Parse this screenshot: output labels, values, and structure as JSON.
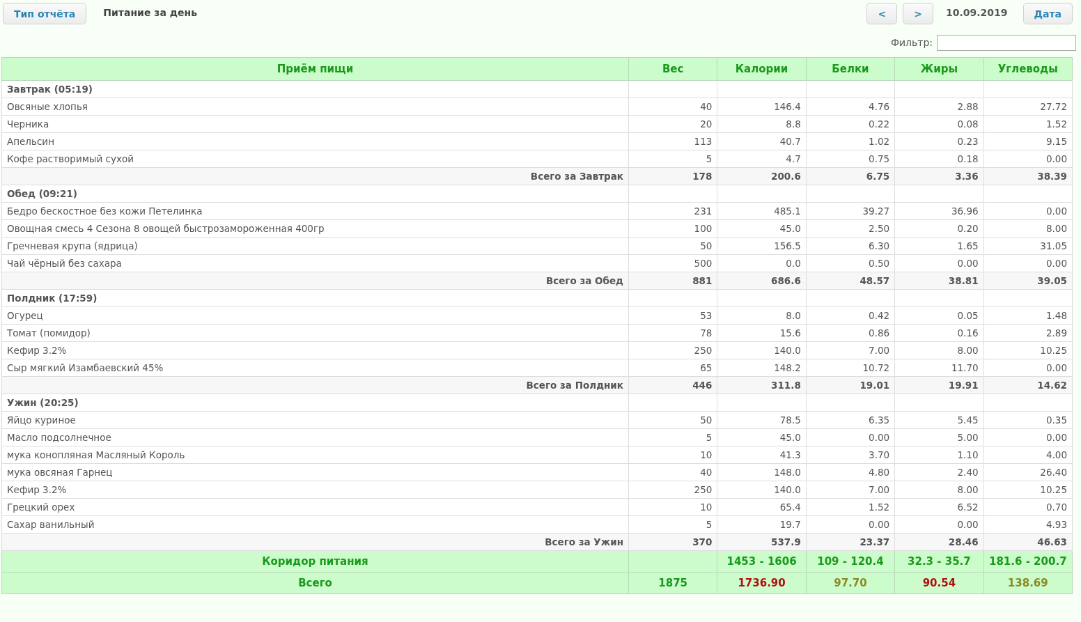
{
  "toolbar": {
    "report_type_button": "Тип отчёта",
    "report_title": "Питание за день",
    "prev_button": "<",
    "next_button": ">",
    "date": "10.09.2019",
    "date_button": "Дата"
  },
  "filter": {
    "label": "Фильтр:"
  },
  "table": {
    "columns": [
      "Приём пищи",
      "Вес",
      "Калории",
      "Белки",
      "Жиры",
      "Углеводы"
    ],
    "meals": [
      {
        "title": "Завтрак (05:19)",
        "items": [
          {
            "name": "Овсяные хлопья",
            "values": [
              "40",
              "146.4",
              "4.76",
              "2.88",
              "27.72"
            ]
          },
          {
            "name": "Черника",
            "values": [
              "20",
              "8.8",
              "0.22",
              "0.08",
              "1.52"
            ]
          },
          {
            "name": "Апельсин",
            "values": [
              "113",
              "40.7",
              "1.02",
              "0.23",
              "9.15"
            ]
          },
          {
            "name": "Кофе растворимый сухой",
            "values": [
              "5",
              "4.7",
              "0.75",
              "0.18",
              "0.00"
            ]
          }
        ],
        "total": {
          "label": "Всего за Завтрак",
          "values": [
            "178",
            "200.6",
            "6.75",
            "3.36",
            "38.39"
          ]
        }
      },
      {
        "title": "Обед (09:21)",
        "items": [
          {
            "name": "Бедро бескостное без кожи Петелинка",
            "values": [
              "231",
              "485.1",
              "39.27",
              "36.96",
              "0.00"
            ]
          },
          {
            "name": "Овощная смесь 4 Сезона 8 овощей быстрозамороженная 400гр",
            "values": [
              "100",
              "45.0",
              "2.50",
              "0.20",
              "8.00"
            ]
          },
          {
            "name": "Гречневая крупа (ядрица)",
            "values": [
              "50",
              "156.5",
              "6.30",
              "1.65",
              "31.05"
            ]
          },
          {
            "name": "Чай чёрный без сахара",
            "values": [
              "500",
              "0.0",
              "0.50",
              "0.00",
              "0.00"
            ]
          }
        ],
        "total": {
          "label": "Всего за Обед",
          "values": [
            "881",
            "686.6",
            "48.57",
            "38.81",
            "39.05"
          ]
        }
      },
      {
        "title": "Полдник (17:59)",
        "items": [
          {
            "name": "Огурец",
            "values": [
              "53",
              "8.0",
              "0.42",
              "0.05",
              "1.48"
            ]
          },
          {
            "name": "Томат (помидор)",
            "values": [
              "78",
              "15.6",
              "0.86",
              "0.16",
              "2.89"
            ]
          },
          {
            "name": "Кефир 3.2%",
            "values": [
              "250",
              "140.0",
              "7.00",
              "8.00",
              "10.25"
            ]
          },
          {
            "name": "Сыр мягкий Изамбаевский 45%",
            "values": [
              "65",
              "148.2",
              "10.72",
              "11.70",
              "0.00"
            ]
          }
        ],
        "total": {
          "label": "Всего за Полдник",
          "values": [
            "446",
            "311.8",
            "19.01",
            "19.91",
            "14.62"
          ]
        }
      },
      {
        "title": "Ужин (20:25)",
        "items": [
          {
            "name": "Яйцо куриное",
            "values": [
              "50",
              "78.5",
              "6.35",
              "5.45",
              "0.35"
            ]
          },
          {
            "name": "Масло подсолнечное",
            "values": [
              "5",
              "45.0",
              "0.00",
              "5.00",
              "0.00"
            ]
          },
          {
            "name": "мука конопляная Масляный Король",
            "values": [
              "10",
              "41.3",
              "3.70",
              "1.10",
              "4.00"
            ]
          },
          {
            "name": "мука овсяная Гарнец",
            "values": [
              "40",
              "148.0",
              "4.80",
              "2.40",
              "26.40"
            ]
          },
          {
            "name": "Кефир 3.2%",
            "values": [
              "250",
              "140.0",
              "7.00",
              "8.00",
              "10.25"
            ]
          },
          {
            "name": "Грецкий орех",
            "values": [
              "10",
              "65.4",
              "1.52",
              "6.52",
              "0.70"
            ]
          },
          {
            "name": "Сахар ванильный",
            "values": [
              "5",
              "19.7",
              "0.00",
              "0.00",
              "4.93"
            ]
          }
        ],
        "total": {
          "label": "Всего за Ужин",
          "values": [
            "370",
            "537.9",
            "23.37",
            "28.46",
            "46.63"
          ]
        }
      }
    ],
    "corridor": {
      "label": "Коридор питания",
      "values": [
        {
          "text": "1453 - 1606",
          "color": "#1a9a1a"
        },
        {
          "text": "109 - 120.4",
          "color": "#1a9a1a"
        },
        {
          "text": "32.3 - 35.7",
          "color": "#1a9a1a"
        },
        {
          "text": "181.6 - 200.7",
          "color": "#1a9a1a"
        }
      ]
    },
    "grand_total": {
      "label": "Всего",
      "values": [
        {
          "text": "1875",
          "color": "#1a9a1a"
        },
        {
          "text": "1736.90",
          "color": "#b01010"
        },
        {
          "text": "97.70",
          "color": "#8a8a20"
        },
        {
          "text": "90.54",
          "color": "#b01010"
        },
        {
          "text": "138.69",
          "color": "#8a8a20"
        }
      ]
    }
  }
}
